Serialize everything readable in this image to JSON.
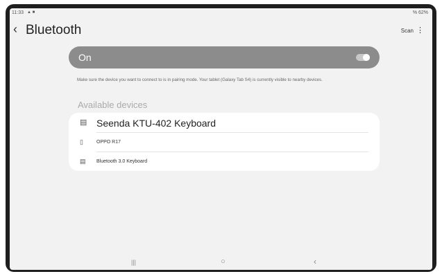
{
  "statusbar": {
    "time": "11:33",
    "left_icons": "▲ ■",
    "battery": "% 62%"
  },
  "header": {
    "back_icon": "‹",
    "title": "Bluetooth",
    "scan_label": "Scan",
    "more_icon": "⋮"
  },
  "bluetooth_toggle": {
    "label": "On",
    "state": true
  },
  "info_text": "Make sure the device you want to connect to is in pairing mode. Your tablet (Galaxy Tab S4) is currently visible to nearby devices.",
  "available": {
    "label": "Available devices",
    "devices": [
      {
        "name": "Seenda KTU-402 Keyboard",
        "icon": "keyboard-icon",
        "glyph": "▤"
      },
      {
        "name": "OPPO R17",
        "icon": "phone-icon",
        "glyph": "▯"
      },
      {
        "name": "Bluetooth 3.0 Keyboard",
        "icon": "keyboard-icon",
        "glyph": "▤"
      }
    ]
  },
  "navbar": {
    "recent_icon": "|||",
    "home_icon": "○",
    "back_icon": "‹"
  }
}
